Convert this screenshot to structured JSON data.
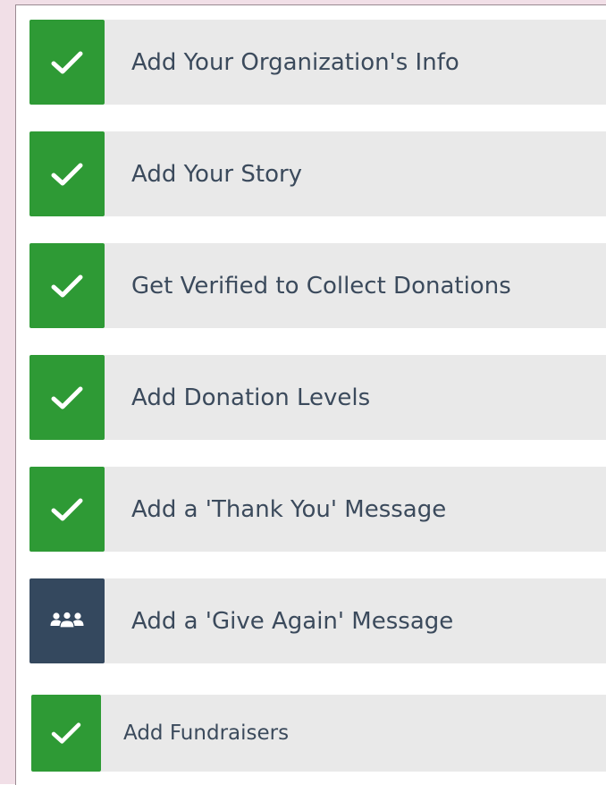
{
  "checklist": {
    "steps": [
      {
        "label": "Add Your Organization's Info",
        "status": "complete",
        "icon": "check-icon"
      },
      {
        "label": "Add Your Story",
        "status": "complete",
        "icon": "check-icon"
      },
      {
        "label": "Get Verified to Collect Donations",
        "status": "complete",
        "icon": "check-icon"
      },
      {
        "label": "Add Donation Levels",
        "status": "complete",
        "icon": "check-icon"
      },
      {
        "label": "Add a 'Thank You' Message",
        "status": "complete",
        "icon": "check-icon"
      },
      {
        "label": "Add a 'Give Again' Message",
        "status": "pending",
        "icon": "users-icon"
      },
      {
        "label": "Add Fundraisers",
        "status": "complete",
        "icon": "check-icon"
      }
    ]
  },
  "colors": {
    "complete": "#2e9a35",
    "pending": "#34485e",
    "bar": "#e9e9e9",
    "text": "#3b4a5c"
  }
}
